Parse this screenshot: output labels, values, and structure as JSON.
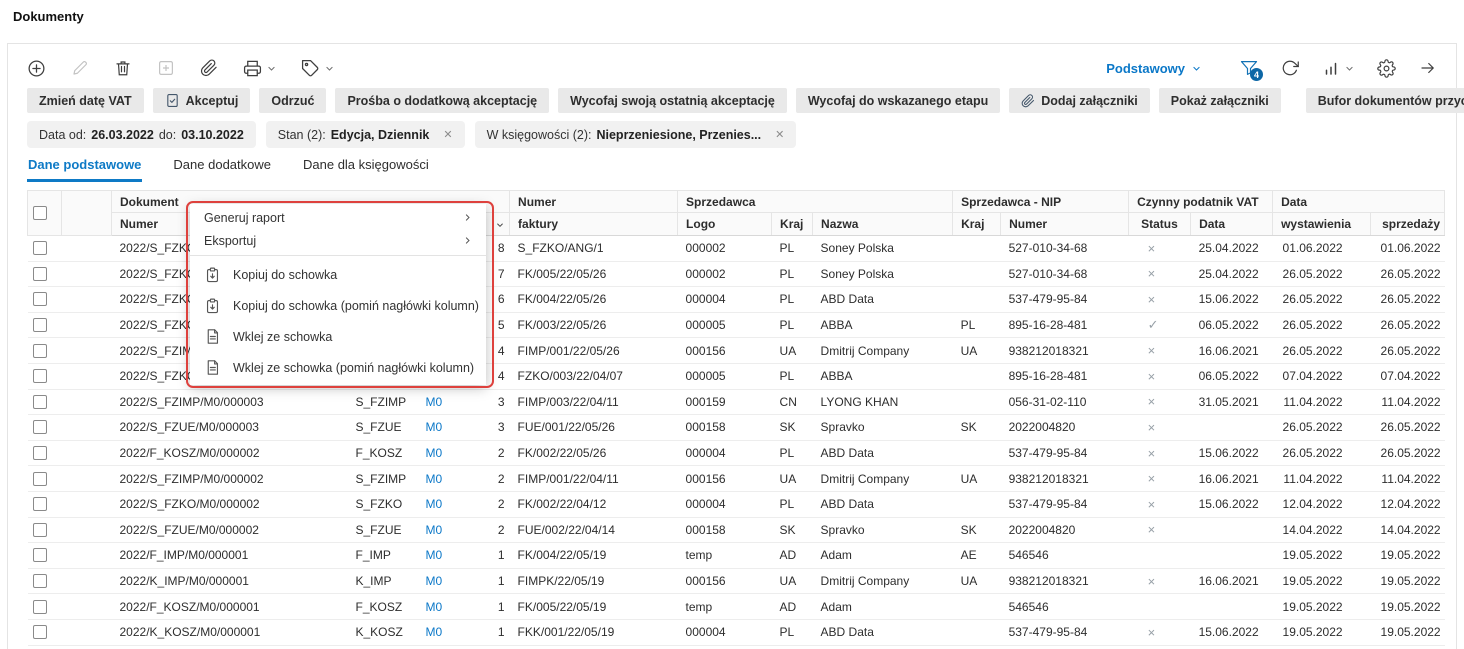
{
  "page": {
    "title": "Dokumenty"
  },
  "toolbar": {
    "left_icons": [
      {
        "name": "add-icon",
        "disabled": false
      },
      {
        "name": "edit-icon",
        "disabled": true
      },
      {
        "name": "delete-icon",
        "disabled": false
      },
      {
        "name": "duplicate-icon",
        "disabled": true
      },
      {
        "name": "attachment-icon",
        "disabled": false
      },
      {
        "name": "print-icon",
        "disabled": false,
        "caret": true
      },
      {
        "name": "tags-icon",
        "disabled": false,
        "caret": true
      }
    ],
    "view_selector": {
      "label": "Podstawowy"
    },
    "right_icons": [
      {
        "name": "filter-icon",
        "badge": "4",
        "active": true
      },
      {
        "name": "refresh-icon"
      },
      {
        "name": "chart-icon",
        "caret": true
      },
      {
        "name": "settings-icon"
      },
      {
        "name": "expand-right-icon"
      }
    ]
  },
  "action_buttons": [
    {
      "label": "Zmień datę VAT"
    },
    {
      "label": "Akceptuj",
      "icon": "accept-document-icon"
    },
    {
      "label": "Odrzuć"
    },
    {
      "label": "Prośba o dodatkową akceptację"
    },
    {
      "label": "Wycofaj swoją ostatnią akceptację"
    },
    {
      "label": "Wycofaj do wskazanego etapu"
    },
    {
      "label": "Dodaj załączniki",
      "icon": "paperclip-icon"
    },
    {
      "label": "Pokaż załączniki"
    },
    {
      "label": "Bufor dokumentów przychodzących",
      "gap_before": true
    }
  ],
  "more_button": {
    "icon": "more-vertical-icon"
  },
  "filter_chips": [
    {
      "name": "date-filter-chip",
      "closable": false,
      "parts": [
        {
          "text": "Data od:",
          "bold": false
        },
        {
          "text": "26.03.2022",
          "bold": true
        },
        {
          "text": "do:",
          "bold": false
        },
        {
          "text": "03.10.2022",
          "bold": true
        }
      ]
    },
    {
      "name": "state-filter-chip",
      "closable": true,
      "parts": [
        {
          "text": "Stan (2):",
          "bold": false
        },
        {
          "text": "Edycja, Dziennik",
          "bold": true
        }
      ]
    },
    {
      "name": "accounting-filter-chip",
      "closable": true,
      "parts": [
        {
          "text": "W księgowości (2):",
          "bold": false
        },
        {
          "text": "Nieprzeniesione, Przenies...",
          "bold": true
        }
      ]
    }
  ],
  "tabs": [
    {
      "label": "Dane podstawowe",
      "active": true
    },
    {
      "label": "Dane dodatkowe",
      "active": false
    },
    {
      "label": "Dane dla księgowości",
      "active": false
    }
  ],
  "table": {
    "header_groups": [
      {
        "label": "Dokument",
        "span": 4
      },
      {
        "label": "Numer",
        "span": 1
      },
      {
        "label": "Sprzedawca",
        "span": 3
      },
      {
        "label": "Sprzedawca - NIP",
        "span": 2
      },
      {
        "label": "Czynny podatnik VAT",
        "span": 2
      },
      {
        "label": "Data",
        "span": 2
      }
    ],
    "sub_headers": [
      "Numer",
      "",
      "",
      "",
      "faktury",
      "Logo",
      "Kraj",
      "Nazwa",
      "Kraj",
      "Numer",
      "Status",
      "Data",
      "wystawienia",
      "sprzedaży"
    ],
    "sort_column_index": 3,
    "column_keys": [
      "dokument_numer",
      "symbol",
      "rejestr",
      "lp",
      "numer_faktury",
      "logo",
      "kraj",
      "nazwa",
      "nip_kraj",
      "nip_numer",
      "vat_status",
      "vat_data",
      "data_wystawienia",
      "data_sprzedazy"
    ],
    "rows": [
      [
        "2022/S_FZKO",
        "",
        "",
        "8",
        "S_FZKO/ANG/1",
        "000002",
        "PL",
        "Soney Polska",
        "",
        "527-010-34-68",
        "×",
        "25.04.2022",
        "01.06.2022",
        "01.06.2022"
      ],
      [
        "2022/S_FZKO",
        "",
        "",
        "7",
        "FK/005/22/05/26",
        "000002",
        "PL",
        "Soney Polska",
        "",
        "527-010-34-68",
        "×",
        "25.04.2022",
        "26.05.2022",
        "26.05.2022"
      ],
      [
        "2022/S_FZKO",
        "",
        "",
        "6",
        "FK/004/22/05/26",
        "000004",
        "PL",
        "ABD Data",
        "",
        "537-479-95-84",
        "×",
        "15.06.2022",
        "26.05.2022",
        "26.05.2022"
      ],
      [
        "2022/S_FZKO",
        "",
        "",
        "5",
        "FK/003/22/05/26",
        "000005",
        "PL",
        "ABBA",
        "PL",
        "895-16-28-481",
        "✓",
        "06.05.2022",
        "26.05.2022",
        "26.05.2022"
      ],
      [
        "2022/S_FZIM",
        "",
        "",
        "4",
        "FIMP/001/22/05/26",
        "000156",
        "UA",
        "Dmitrij Company",
        "UA",
        "938212018321",
        "×",
        "16.06.2021",
        "26.05.2022",
        "26.05.2022"
      ],
      [
        "2022/S_FZKO",
        "",
        "",
        "4",
        "FZKO/003/22/04/07",
        "000005",
        "PL",
        "ABBA",
        "",
        "895-16-28-481",
        "×",
        "06.05.2022",
        "07.04.2022",
        "07.04.2022"
      ],
      [
        "2022/S_FZIMP/M0/000003",
        "S_FZIMP",
        "M0",
        "3",
        "FIMP/003/22/04/11",
        "000159",
        "CN",
        "LYONG KHAN",
        "",
        "056-31-02-110",
        "×",
        "31.05.2021",
        "11.04.2022",
        "11.04.2022"
      ],
      [
        "2022/S_FZUE/M0/000003",
        "S_FZUE",
        "M0",
        "3",
        "FUE/001/22/05/26",
        "000158",
        "SK",
        "Spravko",
        "SK",
        "2022004820",
        "×",
        "",
        "26.05.2022",
        "26.05.2022"
      ],
      [
        "2022/F_KOSZ/M0/000002",
        "F_KOSZ",
        "M0",
        "2",
        "FK/002/22/05/26",
        "000004",
        "PL",
        "ABD Data",
        "",
        "537-479-95-84",
        "×",
        "15.06.2022",
        "26.05.2022",
        "26.05.2022"
      ],
      [
        "2022/S_FZIMP/M0/000002",
        "S_FZIMP",
        "M0",
        "2",
        "FIMP/001/22/04/11",
        "000156",
        "UA",
        "Dmitrij Company",
        "UA",
        "938212018321",
        "×",
        "16.06.2021",
        "11.04.2022",
        "11.04.2022"
      ],
      [
        "2022/S_FZKO/M0/000002",
        "S_FZKO",
        "M0",
        "2",
        "FK/002/22/04/12",
        "000004",
        "PL",
        "ABD Data",
        "",
        "537-479-95-84",
        "×",
        "15.06.2022",
        "12.04.2022",
        "12.04.2022"
      ],
      [
        "2022/S_FZUE/M0/000002",
        "S_FZUE",
        "M0",
        "2",
        "FUE/002/22/04/14",
        "000158",
        "SK",
        "Spravko",
        "SK",
        "2022004820",
        "×",
        "",
        "14.04.2022",
        "14.04.2022"
      ],
      [
        "2022/F_IMP/M0/000001",
        "F_IMP",
        "M0",
        "1",
        "FK/004/22/05/19",
        "temp",
        "AD",
        "Adam",
        "AE",
        "546546",
        "",
        "",
        "19.05.2022",
        "19.05.2022"
      ],
      [
        "2022/K_IMP/M0/000001",
        "K_IMP",
        "M0",
        "1",
        "FIMPK/22/05/19",
        "000156",
        "UA",
        "Dmitrij Company",
        "UA",
        "938212018321",
        "×",
        "16.06.2021",
        "19.05.2022",
        "19.05.2022"
      ],
      [
        "2022/F_KOSZ/M0/000001",
        "F_KOSZ",
        "M0",
        "1",
        "FK/005/22/05/19",
        "temp",
        "AD",
        "Adam",
        "",
        "546546",
        "",
        "",
        "19.05.2022",
        "19.05.2022"
      ],
      [
        "2022/K_KOSZ/M0/000001",
        "K_KOSZ",
        "M0",
        "1",
        "FKK/001/22/05/19",
        "000004",
        "PL",
        "ABD Data",
        "",
        "537-479-95-84",
        "×",
        "15.06.2022",
        "19.05.2022",
        "19.05.2022"
      ]
    ]
  },
  "context_menu": {
    "annotation_color": "#de413d",
    "items": [
      {
        "label": "Generuj raport",
        "submenu": true
      },
      {
        "label": "Eksportuj",
        "submenu": true
      },
      {
        "label": "Kopiuj do schowka",
        "icon": "copy-to-clipboard-icon"
      },
      {
        "label": "Kopiuj do schowka (pomiń nagłówki kolumn)",
        "icon": "copy-to-clipboard-icon"
      },
      {
        "label": "Wklej ze schowka",
        "icon": "paste-from-clipboard-icon"
      },
      {
        "label": "Wklej ze schowka (pomiń nagłówki kolumn)",
        "icon": "paste-from-clipboard-icon"
      }
    ]
  }
}
